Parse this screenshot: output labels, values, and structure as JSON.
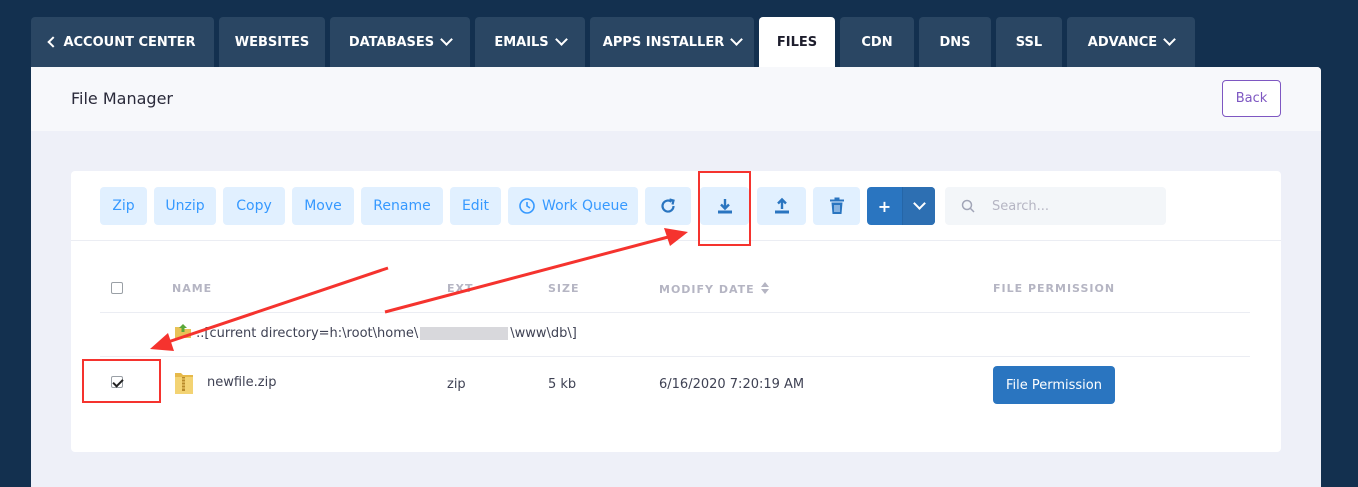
{
  "nav": {
    "tabs": [
      {
        "label": "ACCOUNT CENTER",
        "has_back": true,
        "has_dropdown": false
      },
      {
        "label": "WEBSITES",
        "has_dropdown": false
      },
      {
        "label": "DATABASES",
        "has_dropdown": true
      },
      {
        "label": "EMAILS",
        "has_dropdown": true
      },
      {
        "label": "APPS INSTALLER",
        "has_dropdown": true
      },
      {
        "label": "FILES",
        "has_dropdown": false,
        "active": true
      },
      {
        "label": "CDN",
        "has_dropdown": false
      },
      {
        "label": "DNS",
        "has_dropdown": false
      },
      {
        "label": "SSL",
        "has_dropdown": false
      },
      {
        "label": "ADVANCE",
        "has_dropdown": true
      }
    ]
  },
  "header": {
    "title": "File Manager",
    "back_label": "Back"
  },
  "toolbar": {
    "zip": "Zip",
    "unzip": "Unzip",
    "copy": "Copy",
    "move": "Move",
    "rename": "Rename",
    "edit": "Edit",
    "work_queue": "Work Queue",
    "plus": "+",
    "icons": [
      "refresh-icon",
      "download-icon",
      "upload-icon",
      "trash-icon",
      "chevron-down-icon",
      "search-icon"
    ]
  },
  "search": {
    "placeholder": "Search...",
    "value": ""
  },
  "table": {
    "columns": [
      "NAME",
      "EXT",
      "SIZE",
      "MODIFY DATE",
      "FILE PERMISSION"
    ],
    "current_directory": {
      "prefix": "..[current directory=h:\\root\\home\\",
      "suffix": "\\www\\db\\]"
    },
    "rows": [
      {
        "checked": true,
        "name": "newfile.zip",
        "ext": "zip",
        "size": "5 kb",
        "modified": "6/16/2020 7:20:19 AM",
        "permission_label": "File Permission"
      }
    ]
  },
  "colors": {
    "nav_bg": "#13304f",
    "tab_bg": "#2a4663",
    "primary": "#2a75c0",
    "light_button": "#e1f0ff",
    "annotation_red": "#f5332e",
    "back_border": "#7e57c2"
  }
}
